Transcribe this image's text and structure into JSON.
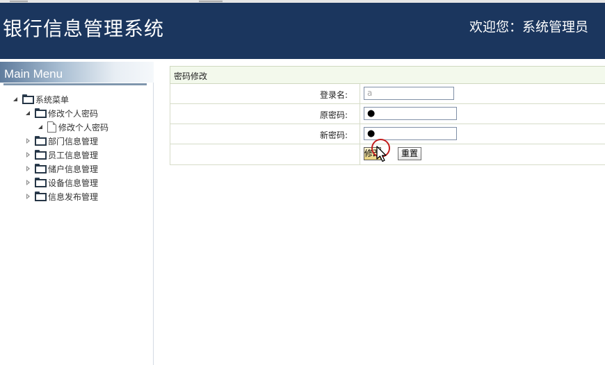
{
  "header": {
    "system_title": "银行信息管理系统",
    "welcome_text": "欢迎您：系统管理员"
  },
  "sidebar": {
    "menu_title": "Main Menu",
    "tree": {
      "root": {
        "label": "系统菜单",
        "expanded": true
      },
      "change_pwd_group": {
        "label": "修改个人密码",
        "expanded": true
      },
      "change_pwd_item": {
        "label": "修改个人密码"
      },
      "dept": {
        "label": "部门信息管理",
        "expanded": false
      },
      "staff": {
        "label": "员工信息管理",
        "expanded": false
      },
      "customer": {
        "label": "储户信息管理",
        "expanded": false
      },
      "device": {
        "label": "设备信息管理",
        "expanded": false
      },
      "notice": {
        "label": "信息发布管理",
        "expanded": false
      }
    }
  },
  "main": {
    "panel_title": "密码修改",
    "form": {
      "username_label": "登录名:",
      "username_value": "a",
      "old_password_label": "原密码:",
      "old_password_mask": "●",
      "new_password_label": "新密码:",
      "new_password_mask": "●",
      "submit_label": "修改",
      "reset_label": "重置"
    }
  },
  "colors": {
    "header_bg": "#1b365e",
    "panel_title_bg": "#f3f9ec",
    "click_ring": "#c21c1c"
  },
  "icons": {
    "tree_expanded": "triangle-down-icon",
    "tree_collapsed": "triangle-right-icon",
    "folder": "folder-icon",
    "document": "document-icon",
    "cursor": "mouse-cursor-icon"
  }
}
